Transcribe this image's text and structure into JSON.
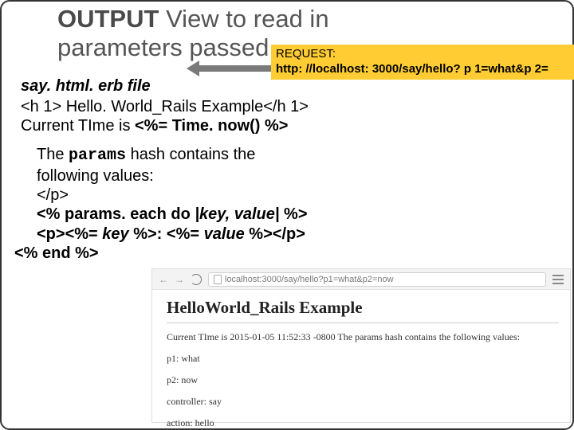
{
  "title": {
    "strong": "OUTPUT",
    "rest1": "View to read in",
    "line2": "parameters passed"
  },
  "request": {
    "label": "REQUEST:",
    "url": "http: //localhost: 3000/say/hello? p 1=what&p 2="
  },
  "file_label": "say. html. erb file",
  "code_h1": "<h 1> Hello. World_Rails Example</h 1>",
  "code_time_prefix": "Current TIme is ",
  "code_time_erb": "<%= Time. now() %>",
  "para": {
    "l1a": "The ",
    "l1b": "params",
    "l1c": " hash contains the",
    "l2": "following values:",
    "l3": "</p>",
    "l4a": "<% params. each do ",
    "l4b": "|key, value|",
    "l4c": " %>",
    "l5a": " <p><%= ",
    "l5b": "key",
    "l5c": " %>: <%= ",
    "l5d": "value",
    "l5e": " %></p>",
    "l6": "<% end %>"
  },
  "browser": {
    "url": "localhost:3000/say/hello?p1=what&p2=now",
    "heading": "HelloWorld_Rails Example",
    "line": "Current TIme is 2015-01-05 11:52:33 -0800 The params hash contains the following values:",
    "kv1": "p1: what",
    "kv2": "p2: now",
    "kv3": "controller: say",
    "kv4": "action: hello"
  }
}
